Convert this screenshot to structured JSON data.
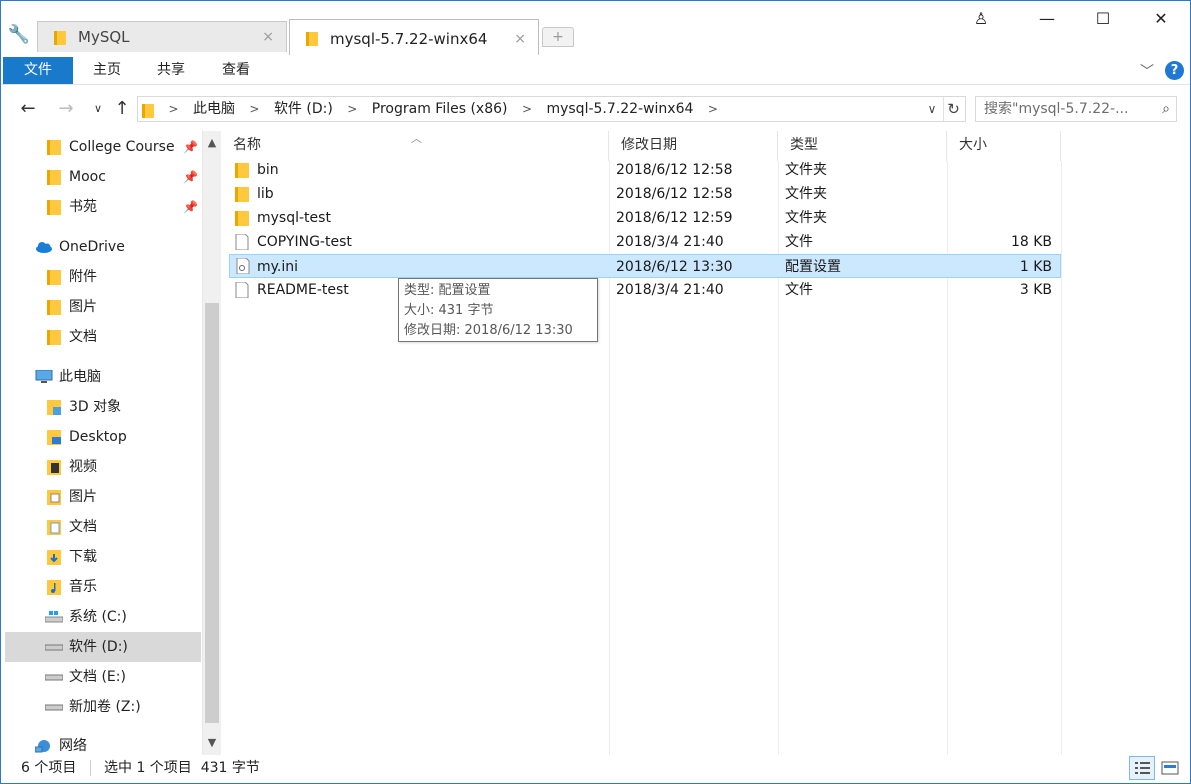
{
  "tabs": [
    {
      "label": "MySQL",
      "close": "×"
    },
    {
      "label": "mysql-5.7.22-winx64",
      "close": "×"
    }
  ],
  "window_controls": {
    "user": "♙",
    "minimize": "—",
    "maximize": "☐",
    "close": "✕"
  },
  "ribbon": {
    "tabs": [
      "文件",
      "主页",
      "共享",
      "查看"
    ],
    "help": "?"
  },
  "address": {
    "crumbs": [
      "此电脑",
      "软件 (D:)",
      "Program Files (x86)",
      "mysql-5.7.22-winx64"
    ],
    "search_placeholder": "搜索\"mysql-5.7.22-..."
  },
  "nav": {
    "quick_access": [
      {
        "label": "College Course",
        "pinned": true
      },
      {
        "label": "Mooc",
        "pinned": true
      },
      {
        "label": "书苑",
        "pinned": true
      }
    ],
    "onedrive": {
      "label": "OneDrive",
      "items": [
        "附件",
        "图片",
        "文档"
      ]
    },
    "this_pc": {
      "label": "此电脑",
      "items": [
        "3D 对象",
        "Desktop",
        "视频",
        "图片",
        "文档",
        "下载",
        "音乐"
      ],
      "drives": [
        "系统 (C:)",
        "软件 (D:)",
        "文档 (E:)",
        "新加卷 (Z:)"
      ]
    },
    "network": "网络",
    "selected": "软件 (D:)"
  },
  "columns": {
    "name": "名称",
    "date": "修改日期",
    "type": "类型",
    "size": "大小"
  },
  "files": [
    {
      "name": "bin",
      "date": "2018/6/12 12:58",
      "type": "文件夹",
      "size": "",
      "kind": "folder"
    },
    {
      "name": "lib",
      "date": "2018/6/12 12:58",
      "type": "文件夹",
      "size": "",
      "kind": "folder"
    },
    {
      "name": "mysql-test",
      "date": "2018/6/12 12:59",
      "type": "文件夹",
      "size": "",
      "kind": "folder"
    },
    {
      "name": "COPYING-test",
      "date": "2018/3/4 21:40",
      "type": "文件",
      "size": "18 KB",
      "kind": "file"
    },
    {
      "name": "my.ini",
      "date": "2018/6/12 13:30",
      "type": "配置设置",
      "size": "1 KB",
      "kind": "ini"
    },
    {
      "name": "README-test",
      "date": "2018/3/4 21:40",
      "type": "文件",
      "size": "3 KB",
      "kind": "file"
    }
  ],
  "selected_file": "my.ini",
  "tooltip": {
    "type": "类型: 配置设置",
    "size": "大小: 431 字节",
    "modified": "修改日期: 2018/6/12 13:30"
  },
  "status": {
    "count": "6 个项目",
    "selection": "选中 1 个项目  431 字节"
  },
  "colors": {
    "accent": "#1979ca",
    "selection": "#cce8ff",
    "folder": "#ffc83d"
  }
}
